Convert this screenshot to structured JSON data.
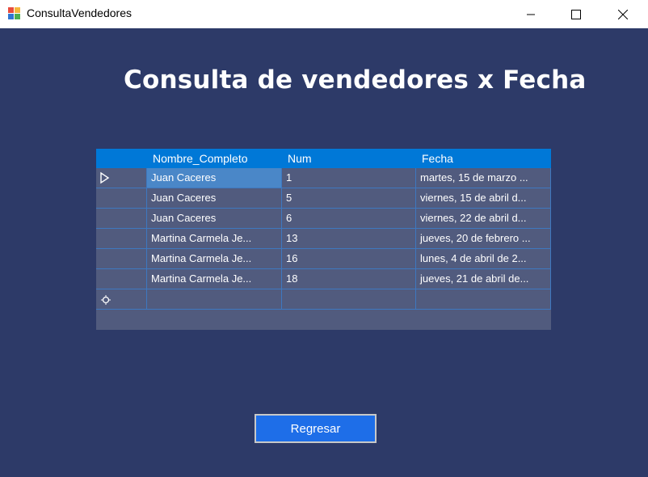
{
  "window": {
    "title": "ConsultaVendedores",
    "controls": {
      "minimize": "minimize-icon",
      "maximize": "maximize-icon",
      "close": "close-icon"
    }
  },
  "heading": "Consulta de vendedores x Fecha",
  "grid": {
    "columns": [
      "Nombre_Completo",
      "Num",
      "Fecha"
    ],
    "rows": [
      {
        "nombre": "Juan Caceres",
        "num": "1",
        "fecha": "martes, 15 de marzo ...",
        "current": true
      },
      {
        "nombre": "Juan Caceres",
        "num": "5",
        "fecha": "viernes, 15 de abril d..."
      },
      {
        "nombre": "Juan Caceres",
        "num": "6",
        "fecha": "viernes, 22 de abril d..."
      },
      {
        "nombre": "Martina Carmela Je...",
        "num": "13",
        "fecha": "jueves, 20 de febrero ..."
      },
      {
        "nombre": "Martina Carmela Je...",
        "num": "16",
        "fecha": "lunes, 4 de abril de 2..."
      },
      {
        "nombre": "Martina Carmela Je...",
        "num": "18",
        "fecha": "jueves, 21 de abril de..."
      }
    ],
    "new_row_icon": "new-row-icon",
    "current_row_icon": "current-row-arrow-icon"
  },
  "button": {
    "label": "Regresar"
  },
  "colors": {
    "background": "#2d3a68",
    "grid_header": "#0078d7",
    "grid_cell": "#515b7e",
    "selected_cell": "#4a87c8",
    "button": "#1e6ee8"
  }
}
